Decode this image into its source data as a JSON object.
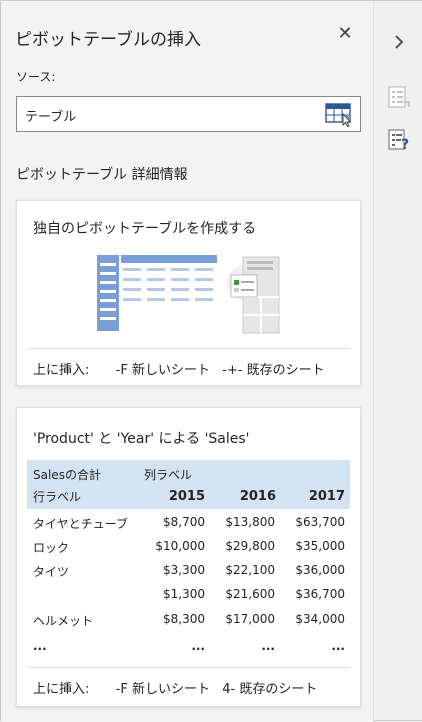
{
  "pane": {
    "title": "ピボットテーブルの挿入",
    "close_glyph": "✕"
  },
  "source": {
    "label": "ソース:",
    "value": "テーブル",
    "range_selector_icon": "table-select-icon"
  },
  "section_label": "ピボットテーブル 詳細情報",
  "blank_card": {
    "title": "独自のピボットテーブルを作成する",
    "insert_label": "上に挿入:",
    "option_new": "-F 新しいシート",
    "option_existing": "-+- 既存のシート"
  },
  "recommended_card": {
    "title": "'Product' と 'Year' による 'Sales'",
    "value_header": "Salesの合計",
    "column_labels": "列ラベル",
    "row_labels": "行ラベル",
    "years": [
      "2015",
      "2016",
      "2017"
    ],
    "rows": [
      {
        "label": "タイヤとチューブ",
        "values": [
          "$8,700",
          "$13,800",
          "$63,700"
        ]
      },
      {
        "label": "ロック",
        "values": [
          "$10,000",
          "$29,800",
          "$35,000"
        ]
      },
      {
        "label": " タイツ",
        "values": [
          "$3,300",
          "$22,100",
          "$36,000"
        ]
      },
      {
        "label": "",
        "values": [
          "$1,300",
          "$21,600",
          "$36,700"
        ]
      },
      {
        "label": "ヘルメット",
        "values": [
          "$8,300",
          "$17,000",
          "$34,000"
        ]
      },
      {
        "label": "...",
        "values": [
          "...",
          "...",
          "..."
        ]
      }
    ],
    "insert_label": "上に挿入:",
    "option_new": "-F 新しいシート",
    "option_existing": "4- 既存のシート"
  },
  "rail": {
    "collapse_icon": "chevron-right-icon",
    "icons": [
      "pivot-recommend-icon",
      "help-document-icon"
    ]
  },
  "colors": {
    "accent": "#2b579a",
    "table_header": "#d4e3f1",
    "illustration_blue": "#7a9fd6"
  }
}
